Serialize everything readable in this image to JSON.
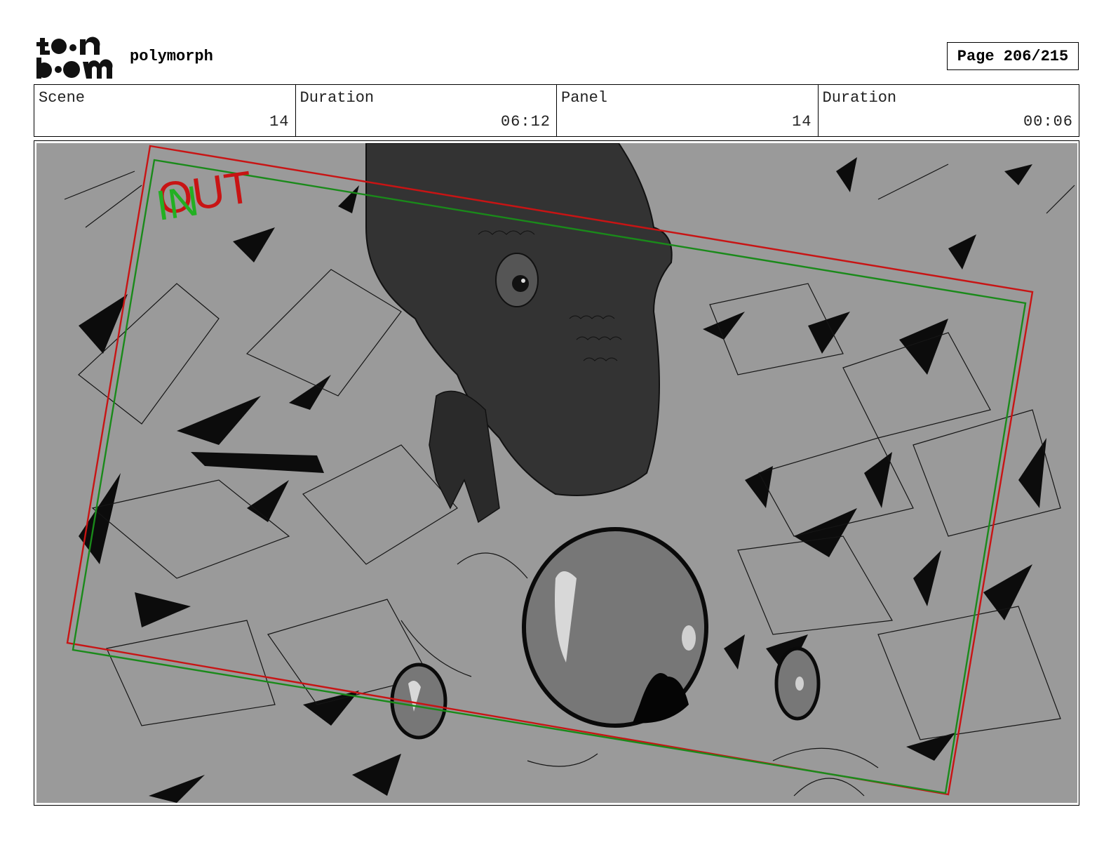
{
  "header": {
    "logo_text": "toon boom",
    "project_name": "polymorph",
    "page_label": "Page 206/215"
  },
  "info": {
    "scene_label": "Scene",
    "scene_value": "14",
    "scene_duration_label": "Duration",
    "scene_duration_value": "06:12",
    "panel_label": "Panel",
    "panel_value": "14",
    "panel_duration_label": "Duration",
    "panel_duration_value": "00:06"
  },
  "panel": {
    "in_label": "IN",
    "out_label": "OUT",
    "in_color": "#1a8a1a",
    "out_color": "#c81414",
    "background_color": "#9a9a9a"
  }
}
